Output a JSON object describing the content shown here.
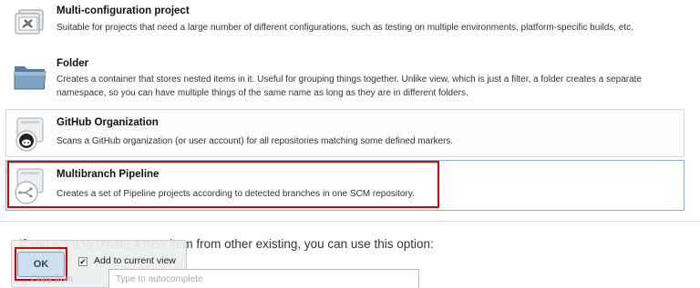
{
  "items": [
    {
      "id": "multiconfig",
      "title": "Multi-configuration project",
      "description": "Suitable for projects that need a large number of different configurations, such as testing on multiple environments, platform-specific builds, etc.",
      "icon": "multi-configuration-icon"
    },
    {
      "id": "folder",
      "title": "Folder",
      "description": "Creates a container that stores nested items in it. Useful for grouping things together. Unlike view, which is just a filter, a folder creates a separate namespace, so you can have multiple things of the same name as long as they are in different folders.",
      "icon": "folder-icon"
    },
    {
      "id": "github",
      "title": "GitHub Organization",
      "description": "Scans a GitHub organization (or user account) for all repositories matching some defined markers.",
      "icon": "github-organization-icon"
    },
    {
      "id": "multibranch",
      "title": "Multibranch Pipeline",
      "description": "Creates a set of Pipeline projects according to detected branches in one SCM repository.",
      "icon": "multibranch-pipeline-icon",
      "selected": true
    }
  ],
  "copy_hint": "If you want to create a new item from other existing, you can use this option:",
  "ok_popup": {
    "ok_label": "OK",
    "add_to_view_label": "Add to current view",
    "add_to_view_checked": true
  },
  "copy_from": {
    "label": "Copy from",
    "placeholder": "Type to autocomplete",
    "value": ""
  },
  "colors": {
    "highlight": "#e00000",
    "selected_border": "#8aaed4",
    "ok_button_bg": "#cfe0f1"
  }
}
